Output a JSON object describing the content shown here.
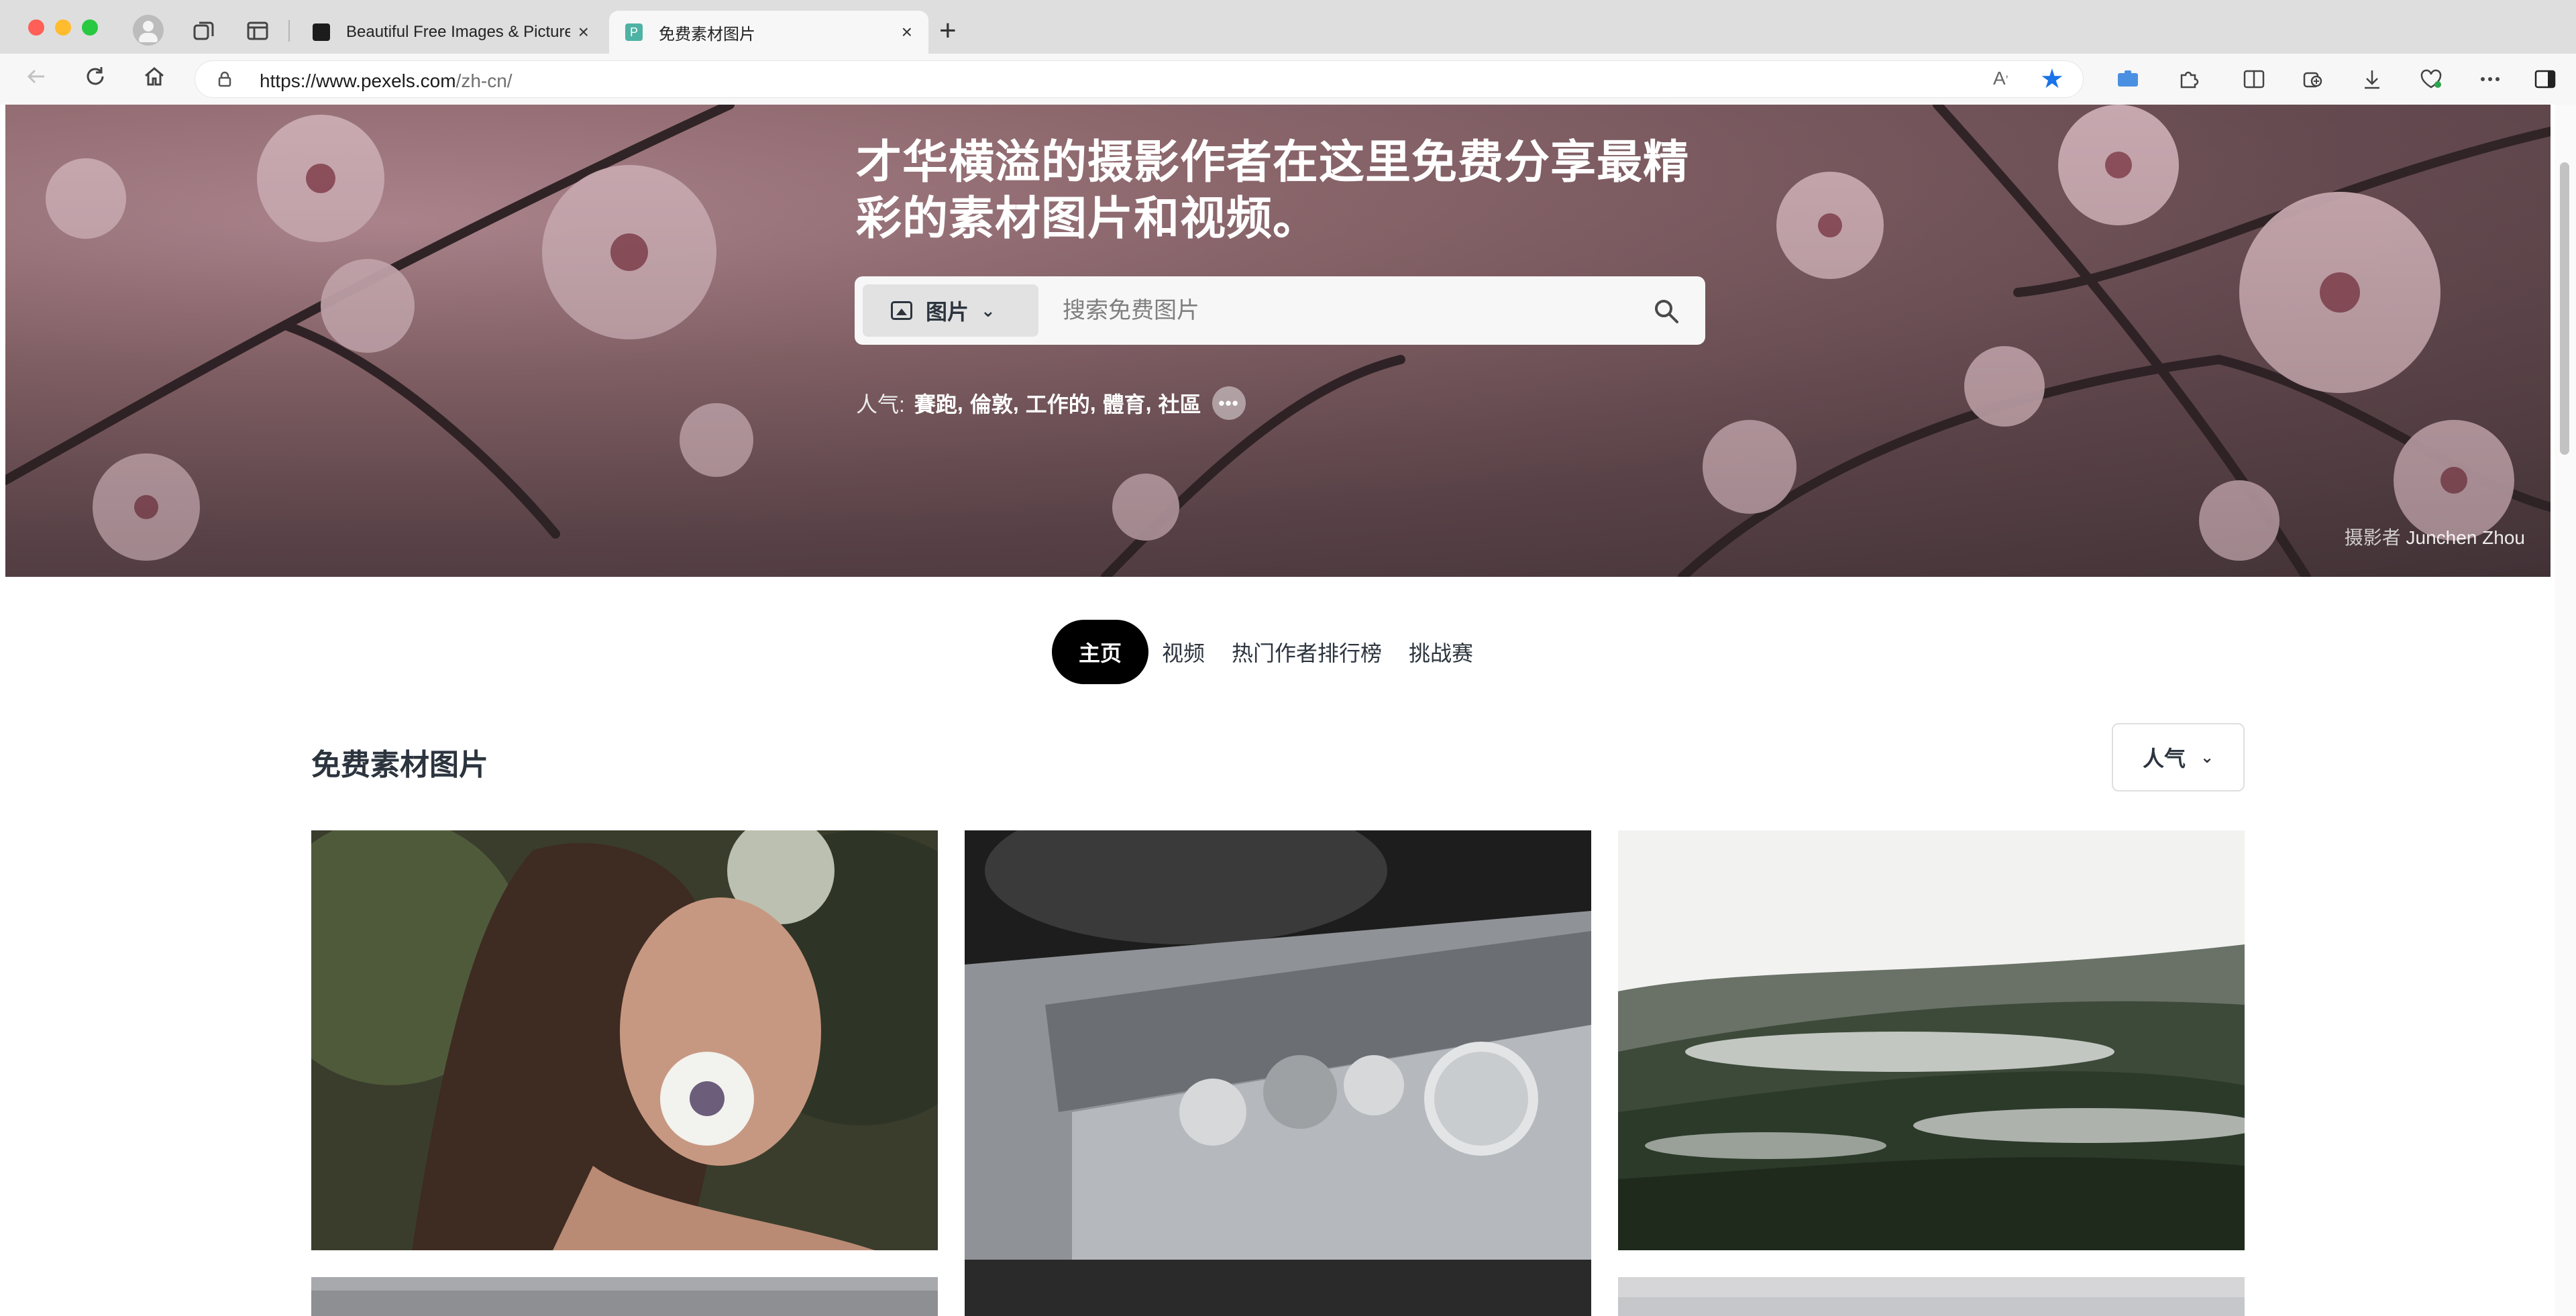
{
  "browser": {
    "tabs": [
      {
        "title": "Beautiful Free Images & Pictures | Unsplash",
        "active": false,
        "favicon_icon": "unsplash-logo"
      },
      {
        "title": "免费素材图片",
        "active": true,
        "favicon_icon": "pexels-logo",
        "favicon_letter": "P"
      }
    ],
    "new_tab_label": "+",
    "close_label": "×",
    "address": {
      "scheme": "https://",
      "host": "www.pexels.com",
      "path": "/zh-cn/"
    }
  },
  "hero": {
    "title": "才华横溢的摄影作者在这里免费分享最精彩的素材图片和视频。",
    "search": {
      "type_label": "图片",
      "placeholder": "搜索免费图片"
    },
    "popular_label": "人气:",
    "popular_tags": [
      "賽跑",
      "倫敦",
      "工作的",
      "體育",
      "社區"
    ],
    "more_label": "•••",
    "credit_prefix": "摄影者",
    "credit_name": "Junchen Zhou"
  },
  "nav": {
    "items": [
      {
        "label": "主页",
        "active": true
      },
      {
        "label": "视频",
        "active": false
      },
      {
        "label": "热门作者排行榜",
        "active": false
      },
      {
        "label": "挑战赛",
        "active": false
      }
    ]
  },
  "section": {
    "title": "免费素材图片",
    "sort_label": "人气"
  },
  "colors": {
    "accent_dark": "#2c343e",
    "pill_active_bg": "#000000",
    "tab_favicon": "#4db3a4",
    "star": "#1a73e8"
  }
}
